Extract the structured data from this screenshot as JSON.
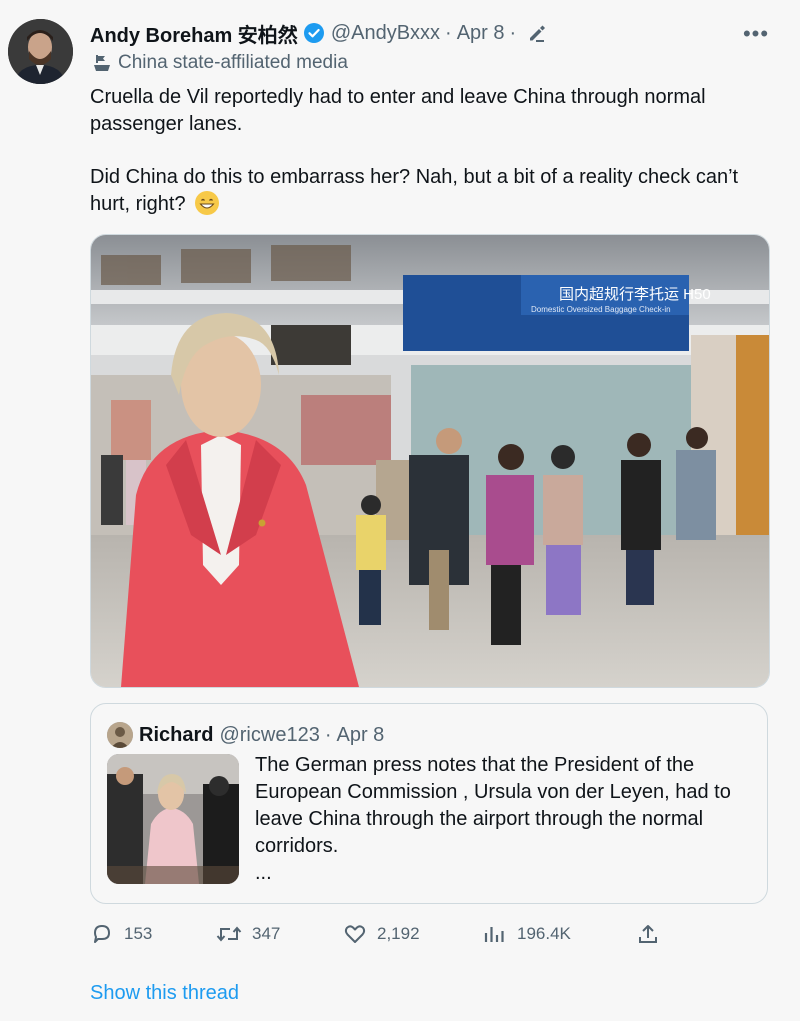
{
  "tweet": {
    "author_name": "Andy Boreham 安柏然",
    "handle": "@AndyBxxx",
    "date": "Apr 8",
    "affiliation_label": "China state-affiliated media",
    "paragraphs": [
      "Cruella de Vil reportedly had to enter and leave China through normal passenger lanes.",
      "Did China do this to embarrass her? Nah, but a bit of a reality check can’t hurt, right?"
    ],
    "photo_signs": {
      "checkin_code": "国内超规行李托运 H50",
      "checkin_subtitle": "Domestic Oversized Baggage Check-in"
    }
  },
  "quote": {
    "author_name": "Richard",
    "handle": "@ricwe123",
    "date": "Apr 8",
    "text": "The German press notes that the President of the European Commission , Ursula von der Leyen, had to leave China through the airport through the normal corridors.",
    "ellipsis": "..."
  },
  "actions": {
    "replies": "153",
    "retweets": "347",
    "likes": "2,192",
    "views": "196.4K"
  },
  "show_thread_label": "Show this thread",
  "colors": {
    "accent": "#1d9bf0",
    "verified": "#1d9bf0",
    "secondary_text": "#536471",
    "blazer": "#e8505b"
  },
  "icons": [
    "verified-badge-icon",
    "edit-icon",
    "more-icon",
    "state-media-icon",
    "reply-icon",
    "retweet-icon",
    "like-icon",
    "views-icon",
    "share-icon",
    "grin-emoji-icon"
  ]
}
